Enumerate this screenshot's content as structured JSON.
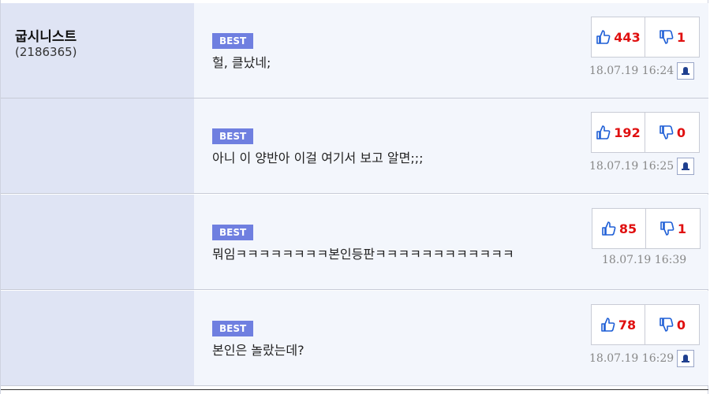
{
  "author": {
    "nickname": "굽시니스트",
    "user_id": "(2186365)"
  },
  "comments": [
    {
      "badge": "BEST",
      "text": "헐, 클났네;",
      "up": "443",
      "down": "1",
      "date": "18.07.19 16:24",
      "has_report": true
    },
    {
      "badge": "BEST",
      "text": "아니 이 양반아 이걸 여기서 보고 알면;;;",
      "up": "192",
      "down": "0",
      "date": "18.07.19 16:25",
      "has_report": true
    },
    {
      "badge": "BEST",
      "text": "뭐임ㅋㅋㅋㅋㅋㅋㅋㅋ본인등판ㅋㅋㅋㅋㅋㅋㅋㅋㅋㅋㅋㅋ",
      "up": "85",
      "down": "1",
      "date": "18.07.19 16:39",
      "has_report": false
    },
    {
      "badge": "BEST",
      "text": "본인은 놀랐는데?",
      "up": "78",
      "down": "0",
      "date": "18.07.19 16:29",
      "has_report": true
    }
  ],
  "colors": {
    "badge_bg": "#6f7fe0",
    "vote_red": "#e01010",
    "icon_blue": "#1f5fd6",
    "author_bg": "#dfe4f4",
    "body_bg": "#f3f6fc"
  },
  "icons": {
    "up": "thumbs-up-icon",
    "down": "thumbs-down-icon",
    "report": "bell-icon"
  }
}
